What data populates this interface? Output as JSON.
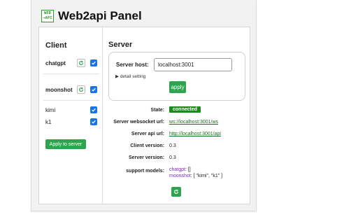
{
  "app": {
    "title": "Web2api Panel",
    "logo_line1": "WEB",
    "logo_line2": "→API"
  },
  "client": {
    "heading": "Client",
    "groups": [
      {
        "label": "chatgpt",
        "checked": true
      },
      {
        "label": "moonshot",
        "checked": true
      }
    ],
    "models": [
      {
        "label": "kimi",
        "checked": true
      },
      {
        "label": "k1",
        "checked": true
      }
    ],
    "apply_label": "Apply to server"
  },
  "server": {
    "heading": "Server",
    "host_label": "Server host:",
    "host_value": "localhost:3001",
    "detail_label": "▶ detail setting",
    "apply_label": "apply",
    "state_label": "State:",
    "state_value": "connected",
    "ws_label": "Server websocket url:",
    "ws_value": "ws://localhost:3001/ws",
    "api_label": "Server api url:",
    "api_value": "http://localhost:3001/api",
    "client_version_label": "Client version:",
    "client_version_value": "0.3",
    "server_version_label": "Server version:",
    "server_version_value": "0.3",
    "models_label": "support models:",
    "models_line1_name": "chatgpt",
    "models_line1_value": ": []",
    "models_line2_name": "moonshot",
    "models_line2_value": ": [ \"kimi\", \"k1\" ]"
  },
  "colors": {
    "accent_green": "#2ea44f",
    "badge_green": "#1e8a1e",
    "checkbox_blue": "#1a73e8",
    "model_name_purple": "#7b2bb6"
  },
  "icons": [
    "refresh-icon",
    "check-icon",
    "triangle-right-icon"
  ]
}
